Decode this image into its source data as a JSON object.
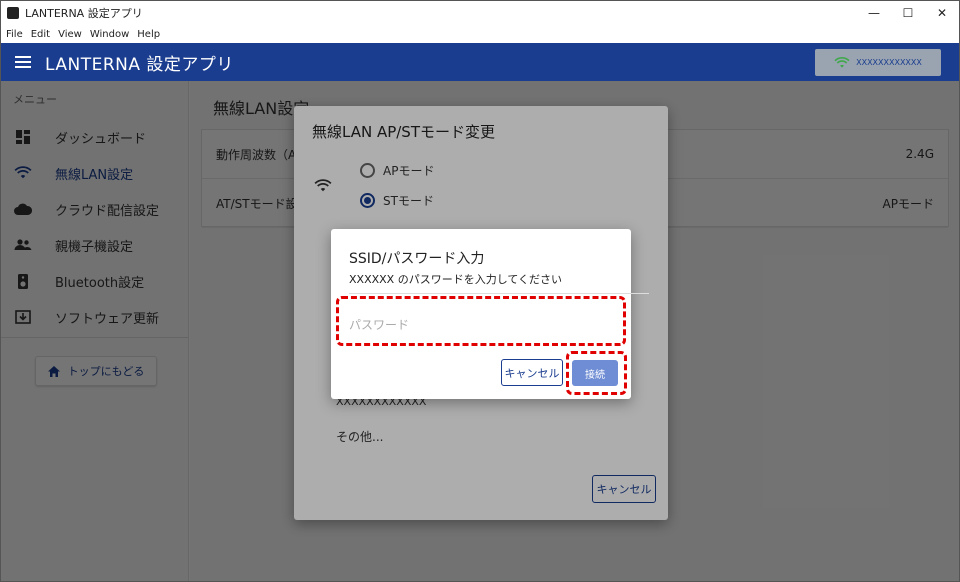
{
  "window": {
    "title": "LANTERNA 設定アプリ",
    "minimize": "—",
    "maximize": "☐",
    "close": "✕"
  },
  "menubar": [
    "File",
    "Edit",
    "View",
    "Window",
    "Help"
  ],
  "appbar": {
    "title": "LANTERNA 設定アプリ",
    "wifi_ssid": "XXXXXXXXXXXX",
    "wifi_color": "#3ea84a"
  },
  "sidebar": {
    "menu_label": "メニュー",
    "items": [
      {
        "label": "ダッシュボード",
        "icon": "dashboard-icon"
      },
      {
        "label": "無線LAN設定",
        "icon": "wifi-icon",
        "active": true
      },
      {
        "label": "クラウド配信設定",
        "icon": "cloud-icon"
      },
      {
        "label": "親機子機設定",
        "icon": "people-icon"
      },
      {
        "label": "Bluetooth設定",
        "icon": "speaker-icon"
      },
      {
        "label": "ソフトウェア更新",
        "icon": "download-icon"
      }
    ],
    "home_button": "トップにもどる"
  },
  "main": {
    "title": "無線LAN設定",
    "rows": [
      {
        "label": "動作周波数（A",
        "value": "2.4G"
      },
      {
        "label": "AT/STモード設",
        "value": "APモード"
      }
    ]
  },
  "dialog1": {
    "title": "無線LAN AP/STモード変更",
    "options": [
      "APモード",
      "STモード"
    ],
    "selected": 1,
    "ssid_item": "XXXXXXXXXXXX",
    "other_item": "その他...",
    "cancel": "キャンセル"
  },
  "dialog2": {
    "title": "SSID/パスワード入力",
    "subtitle": "XXXXXX のパスワードを入力してください",
    "password_placeholder": "パスワード",
    "password_value": "",
    "cancel": "キャンセル",
    "connect": "接続"
  },
  "colors": {
    "primary": "#1a3d8f",
    "highlight": "#e00000",
    "connect_button": "#6f8dd4"
  }
}
